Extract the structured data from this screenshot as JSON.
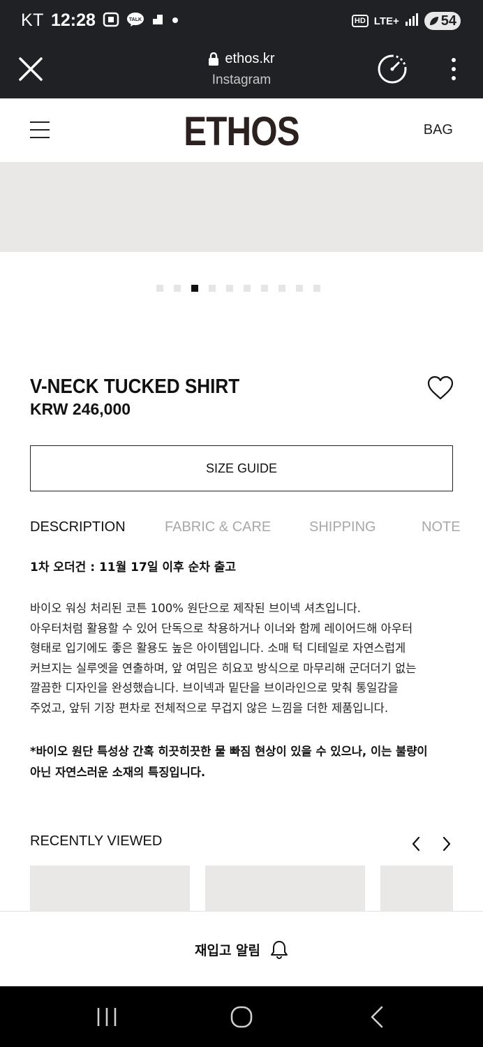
{
  "status_bar": {
    "carrier": "KT",
    "time": "12:28",
    "notification_icons": [
      "screenshot-icon",
      "kakaotalk-icon",
      "app-icon",
      "dot-icon"
    ],
    "network_badge": "HD",
    "network_type": "LTE+",
    "battery": "54"
  },
  "browser": {
    "domain": "ethos.kr",
    "source": "Instagram"
  },
  "header": {
    "logo": "ETHOS",
    "bag_label": "BAG"
  },
  "carousel": {
    "total": 10,
    "active_index": 2
  },
  "product": {
    "name": "V-NECK TUCKED SHIRT",
    "price": "KRW 246,000",
    "size_guide_label": "SIZE GUIDE"
  },
  "tabs": [
    {
      "label": "DESCRIPTION",
      "active": true
    },
    {
      "label": "FABRIC & CARE",
      "active": false
    },
    {
      "label": "SHIPPING",
      "active": false
    },
    {
      "label": "NOTE",
      "active": false
    }
  ],
  "description": {
    "order_note": "1차 오더건 : 11월 17일 이후 순차 출고",
    "lines": [
      "바이오 워싱 처리된 코튼 100% 원단으로 제작된 브이넥 셔츠입니다.",
      "아우터처럼 활용할 수 있어 단독으로 착용하거나 이너와 함께 레이어드해 아우터",
      "형태로 입기에도 좋은 활용도 높은 아이템입니다. 소매 턱 디테일로 자연스럽게",
      "커브지는 실루엣을 연출하며, 앞 여밈은 히요꼬 방식으로 마무리해 군더더기 없는",
      "깔끔한 디자인을 완성했습니다. 브이넥과 밑단을 브이라인으로 맞춰 통일감을",
      "주었고, 앞뒤 기장 편차로 전체적으로 무겁지 않은 느낌을 더한 제품입니다."
    ],
    "notice_lines": [
      "*바이오 원단 특성상 간혹 히끗히끗한 물 빠짐 현상이 있을 수 있으나, 이는 불량이",
      "아닌 자연스러운 소재의 특징입니다."
    ]
  },
  "recently_viewed": {
    "title": "RECENTLY VIEWED"
  },
  "bottom": {
    "restock_label": "재입고 알림"
  },
  "colors": {
    "dark_bar": "#202124",
    "placeholder": "#e9e8e6",
    "logo": "#2b2220",
    "inactive_tab": "#a8a8a8"
  }
}
